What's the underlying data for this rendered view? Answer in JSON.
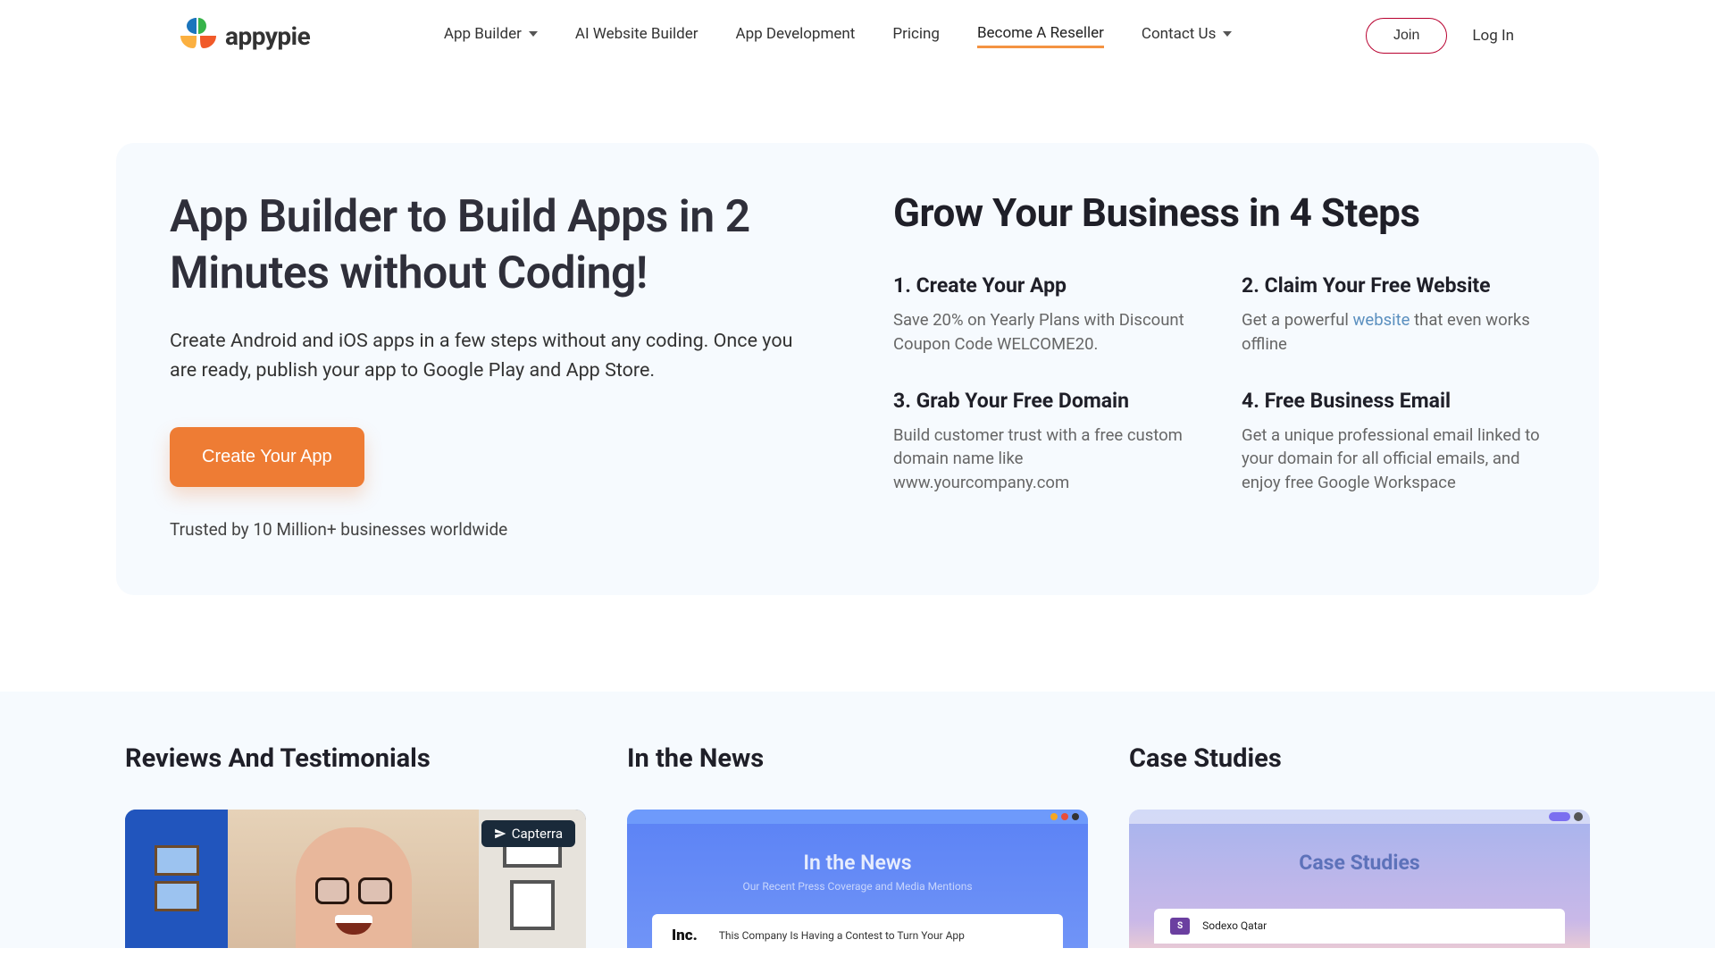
{
  "brand": "appypie",
  "nav": {
    "app_builder": "App Builder",
    "ai_website_builder": "AI Website Builder",
    "app_development": "App Development",
    "pricing": "Pricing",
    "become_reseller": "Become A Reseller",
    "contact_us": "Contact Us"
  },
  "auth": {
    "join": "Join",
    "login": "Log In"
  },
  "hero": {
    "title": "App Builder to Build Apps in 2 Minutes without Coding!",
    "subtitle": "Create Android and iOS apps in a few steps without any coding. Once you are ready, publish your app to Google Play and App Store.",
    "cta": "Create Your App",
    "trusted": "Trusted by 10 Million+ businesses worldwide"
  },
  "steps_title": "Grow Your Business in 4 Steps",
  "steps": {
    "s1": {
      "title": "1. Create Your App",
      "desc": "Save 20% on Yearly Plans with Discount Coupon Code WELCOME20."
    },
    "s2": {
      "title": "2. Claim Your Free Website",
      "desc_pre": "Get a powerful ",
      "link": "website",
      "desc_post": " that even works offline"
    },
    "s3": {
      "title": "3. Grab Your Free Domain",
      "desc": "Build customer trust with a free custom domain name like www.yourcompany.com"
    },
    "s4": {
      "title": "4. Free Business Email",
      "desc": "Get a unique professional email linked to your domain for all official emails, and enjoy free Google Workspace"
    }
  },
  "cards": {
    "reviews": "Reviews And Testimonials",
    "capterra": "Capterra",
    "news": "In the News",
    "news_inner_title": "In the News",
    "news_inner_sub": "Our Recent Press Coverage and Media Mentions",
    "inc": "Inc.",
    "inc_text": "This Company Is Having a Contest to Turn Your App",
    "case": "Case Studies",
    "case_inner_title": "Case Studies",
    "sodexo": "Sodexo Qatar"
  }
}
